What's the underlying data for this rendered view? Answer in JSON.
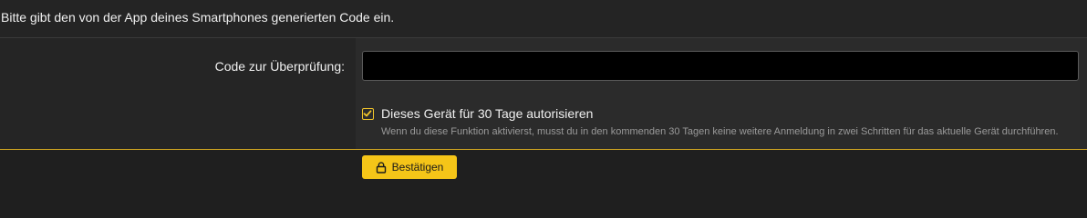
{
  "intro": {
    "text": "Bitte gibt den von der App deines Smartphones generierten Code ein."
  },
  "form": {
    "code_label": "Code zur Überprüfung:",
    "code_value": "",
    "code_placeholder": "",
    "remember": {
      "checked": true,
      "label": "Dieses Gerät für 30 Tage autorisieren",
      "hint": "Wenn du diese Funktion aktivierst, musst du in den kommenden 30 Tagen keine weitere Anmeldung in zwei Schritten für das aktuelle Gerät durchführen."
    }
  },
  "footer": {
    "confirm_label": "Bestätigen",
    "confirm_icon": "lock-icon"
  },
  "colors": {
    "accent": "#f5c518",
    "background": "#1f1f1f",
    "input_background": "#000000"
  }
}
